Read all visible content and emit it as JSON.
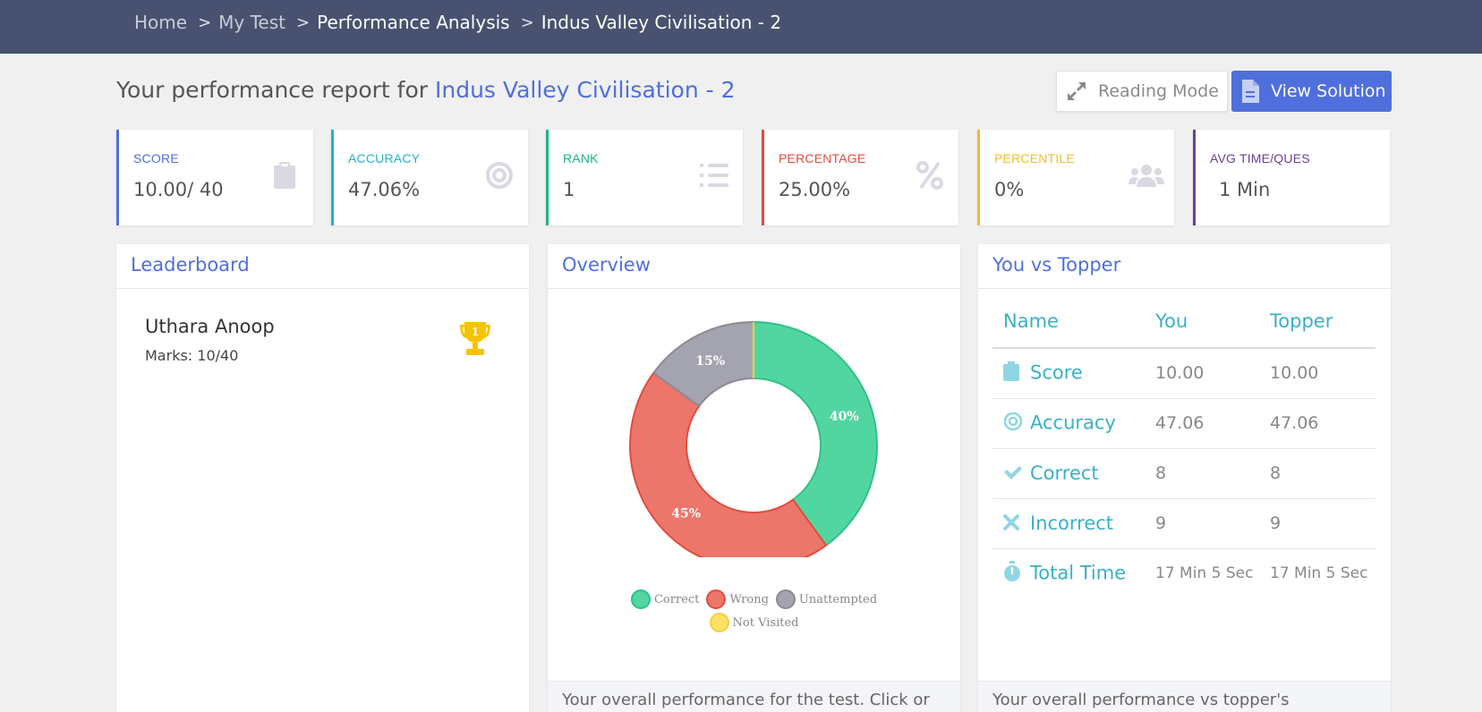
{
  "breadcrumb": [
    "Home",
    "My Test",
    "Performance Analysis",
    "Indus Valley Civilisation - 2"
  ],
  "breadcrumb_separator": ">",
  "header": {
    "prefix": "Your performance report for",
    "test_name": "Indus Valley Civilisation - 2",
    "reading_mode_label": "Reading Mode",
    "view_solution_label": "View Solution"
  },
  "stats": {
    "score": {
      "label": "SCORE",
      "value": "10.00/ 40",
      "color": "#4f6fdc",
      "icon": "clipboard-icon"
    },
    "accuracy": {
      "label": "ACCURACY",
      "value": "47.06%",
      "color": "#22b3c9",
      "icon": "target-icon"
    },
    "rank": {
      "label": "RANK",
      "value": "1",
      "color": "#1ab77d",
      "icon": "list-ordered-icon"
    },
    "percentage": {
      "label": "PERCENTAGE",
      "value": "25.00%",
      "color": "#e24c3e",
      "icon": "percent-icon"
    },
    "percentile": {
      "label": "PERCENTILE",
      "value": "0%",
      "color": "#f2bd2c",
      "icon": "users-icon"
    },
    "avg_time": {
      "label": "AVG TIME/QUES",
      "value": "1 Min",
      "color": "#6a3f9a",
      "icon": ""
    }
  },
  "leaderboard": {
    "title": "Leaderboard",
    "entries": [
      {
        "name": "Uthara Anoop",
        "marks": "Marks: 10/40",
        "rank": "1"
      }
    ]
  },
  "overview": {
    "title": "Overview",
    "footer": "Your overall performance for the test. Click or"
  },
  "chart_data": {
    "type": "pie",
    "categories": [
      "Correct",
      "Wrong",
      "Unattempted",
      "Not Visited"
    ],
    "values": [
      40,
      45,
      15,
      0
    ],
    "labels": [
      "40%",
      "45%",
      "15%",
      ""
    ],
    "colors": [
      "#52d6a1",
      "#ec766b",
      "#a4a4b0",
      "#ffe066"
    ],
    "legend_position": "bottom"
  },
  "vs_topper": {
    "title": "You vs Topper",
    "columns": [
      "Name",
      "You",
      "Topper"
    ],
    "rows": [
      {
        "icon": "clipboard-icon",
        "name": "Score",
        "you": "10.00",
        "topper": "10.00"
      },
      {
        "icon": "target-icon",
        "name": "Accuracy",
        "you": "47.06",
        "topper": "47.06"
      },
      {
        "icon": "check-icon",
        "name": "Correct",
        "you": "8",
        "topper": "8"
      },
      {
        "icon": "cross-icon",
        "name": "Incorrect",
        "you": "9",
        "topper": "9"
      },
      {
        "icon": "stopwatch-icon",
        "name": "Total Time",
        "you": "17 Min 5 Sec",
        "topper": "17 Min 5 Sec"
      }
    ],
    "footer": "Your overall performance vs topper's"
  }
}
